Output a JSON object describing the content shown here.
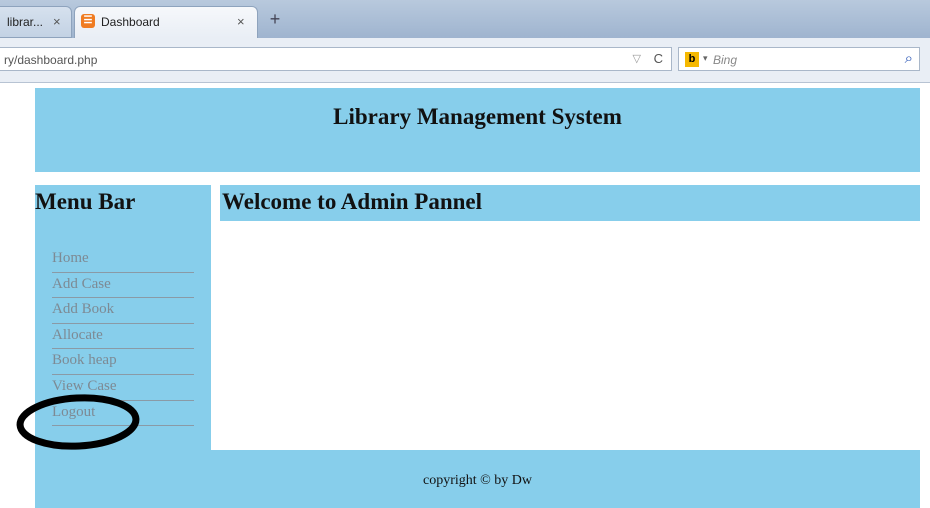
{
  "browser": {
    "tabs": [
      {
        "label": "librar...",
        "close": "×"
      },
      {
        "label": "Dashboard",
        "close": "×"
      }
    ],
    "new_tab": "+",
    "url": "ry/dashboard.php",
    "url_caret": "▽",
    "reload": "C",
    "search_placeholder": "Bing",
    "search_engine_icon": "b",
    "dropdown_glyph": "▾",
    "search_glyph": "⌕"
  },
  "header": {
    "title": "Library Management System"
  },
  "sidebar": {
    "heading": "Menu Bar",
    "items": [
      {
        "label": "Home"
      },
      {
        "label": "Add Case"
      },
      {
        "label": "Add Book"
      },
      {
        "label": "Allocate"
      },
      {
        "label": "Book heap"
      },
      {
        "label": "View Case"
      },
      {
        "label": "Logout"
      }
    ]
  },
  "main": {
    "welcome": "Welcome to Admin Pannel"
  },
  "footer": {
    "copyright": "copyright © by Dw"
  },
  "colors": {
    "panel": "#87ceeb",
    "menu_text": "#7d8a94",
    "annotation": "#000000"
  }
}
